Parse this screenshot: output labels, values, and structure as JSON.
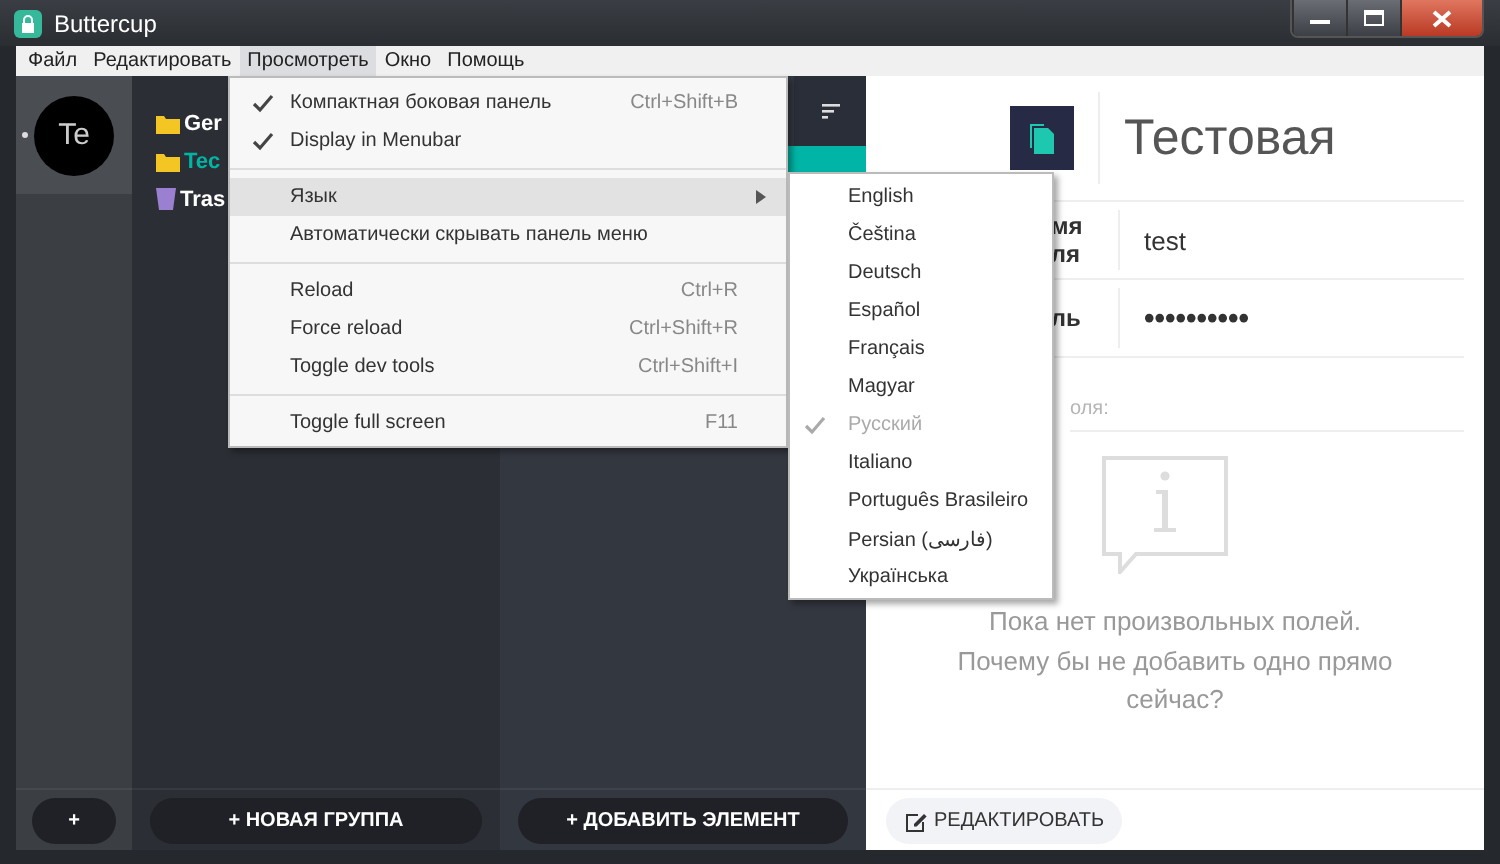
{
  "window": {
    "title": "Buttercup"
  },
  "menubar": [
    {
      "label": "Файл",
      "selected": false
    },
    {
      "label": "Редактировать",
      "selected": false
    },
    {
      "label": "Просмотреть",
      "selected": true
    },
    {
      "label": "Окно",
      "selected": false
    },
    {
      "label": "Помощь",
      "selected": false
    }
  ],
  "view_menu": [
    {
      "kind": "item",
      "label": "Компактная боковая панель",
      "shortcut": "Ctrl+Shift+B",
      "checked": true,
      "selected": false,
      "submenu": false
    },
    {
      "kind": "item",
      "label": "Display in Menubar",
      "checked": true,
      "selected": false,
      "submenu": false
    },
    {
      "kind": "separator"
    },
    {
      "kind": "item",
      "label": "Язык",
      "checked": false,
      "selected": true,
      "submenu": true
    },
    {
      "kind": "item",
      "label": "Автоматически скрывать панель меню",
      "checked": false,
      "selected": false,
      "submenu": false
    },
    {
      "kind": "separator"
    },
    {
      "kind": "item",
      "label": "Reload",
      "shortcut": "Ctrl+R",
      "checked": false,
      "selected": false,
      "submenu": false
    },
    {
      "kind": "item",
      "label": "Force reload",
      "shortcut": "Ctrl+Shift+R",
      "checked": false,
      "selected": false,
      "submenu": false
    },
    {
      "kind": "item",
      "label": "Toggle dev tools",
      "shortcut": "Ctrl+Shift+I",
      "checked": false,
      "selected": false,
      "submenu": false
    },
    {
      "kind": "separator"
    },
    {
      "kind": "item",
      "label": "Toggle full screen",
      "shortcut": "F11",
      "checked": false,
      "selected": false,
      "submenu": false
    }
  ],
  "language_menu": [
    {
      "label": "English",
      "checked": false,
      "disabled": false
    },
    {
      "label": "Čeština",
      "checked": false,
      "disabled": false
    },
    {
      "label": "Deutsch",
      "checked": false,
      "disabled": false
    },
    {
      "label": "Español",
      "checked": false,
      "disabled": false
    },
    {
      "label": "Français",
      "checked": false,
      "disabled": false
    },
    {
      "label": "Magyar",
      "checked": false,
      "disabled": false
    },
    {
      "label": "Русский",
      "checked": true,
      "disabled": true
    },
    {
      "label": "Italiano",
      "checked": false,
      "disabled": false
    },
    {
      "label": "Português Brasileiro",
      "checked": false,
      "disabled": false
    },
    {
      "label": "Persian (فارسی)",
      "checked": false,
      "disabled": false
    },
    {
      "label": "Українська",
      "checked": false,
      "disabled": false
    }
  ],
  "vaults": [
    {
      "initials": "Te",
      "selected": true
    }
  ],
  "vault_add_button": "+",
  "groups": [
    {
      "name": "Ger",
      "kind": "folder",
      "selected": false
    },
    {
      "name": "Tec",
      "kind": "folder",
      "selected": true
    },
    {
      "name": "Tras",
      "kind": "trash",
      "selected": false
    }
  ],
  "new_group_button": "+ НОВАЯ ГРУППА",
  "add_entry_button": "+ ДОБАВИТЬ ЭЛЕМЕНТ",
  "entry": {
    "title": "Тестовая",
    "fields": [
      {
        "label": "мя ля",
        "value": "test",
        "kind": "text"
      },
      {
        "label": "ль",
        "value": "••••••••••",
        "kind": "password"
      }
    ],
    "custom_fields_heading": "оля:",
    "empty_message": "Пока нет произвольных полей. Почему бы не добавить одно прямо сейчас?",
    "edit_button": "РЕДАКТИРОВАТЬ"
  }
}
